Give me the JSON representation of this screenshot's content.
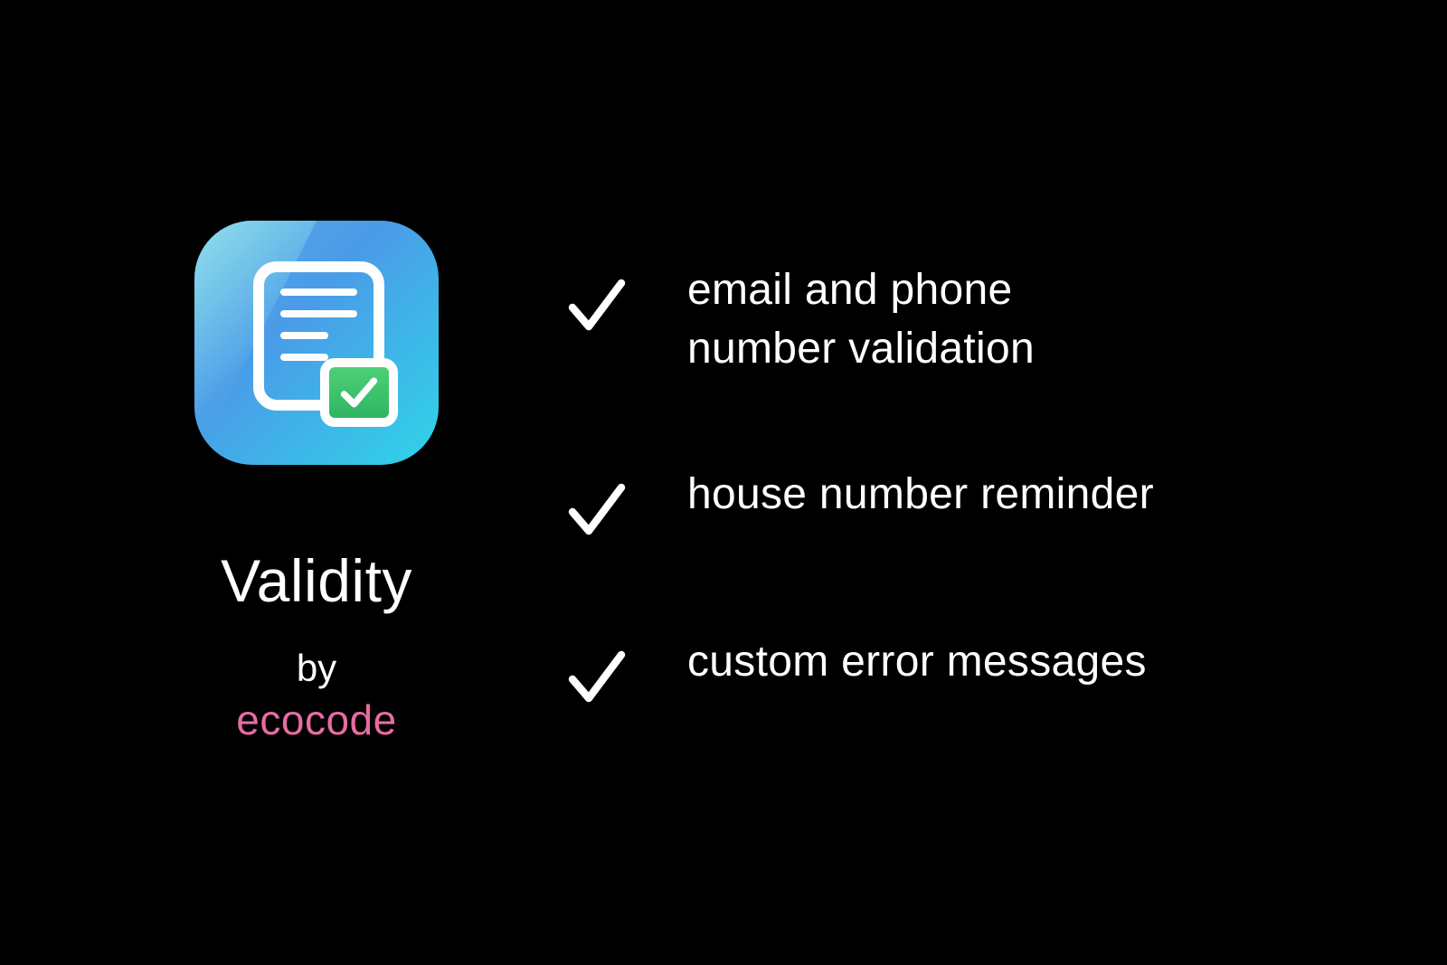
{
  "product": {
    "title": "Validity",
    "by_label": "by",
    "vendor": "ecocode"
  },
  "features": [
    {
      "text": "email and phone number validation"
    },
    {
      "text": "house number reminder"
    },
    {
      "text": "custom error messages"
    }
  ],
  "colors": {
    "background": "#000000",
    "text": "#ffffff",
    "vendor": "#e76ca3",
    "icon_gradient_start": "#5ba3e8",
    "icon_gradient_end": "#2fd4e8",
    "checkbox_green": "#3cc56d"
  }
}
